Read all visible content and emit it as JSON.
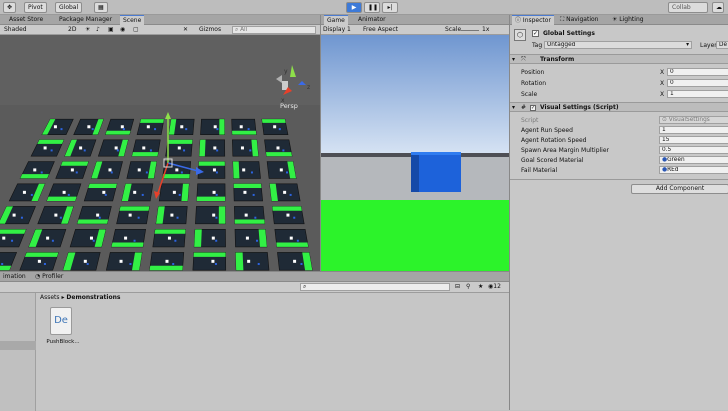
{
  "toolbar": {
    "pivot": "Pivot",
    "global": "Global",
    "collab": "Collab"
  },
  "left_tabs": [
    "Asset Store",
    "Package Manager",
    "Scene"
  ],
  "scene_bar": {
    "shading": "Shaded",
    "mode": "2D",
    "gizmos": "Gizmos",
    "search": "All",
    "persp": "Persp"
  },
  "game_tabs": [
    "Game",
    "Animator"
  ],
  "game_bar": {
    "display": "Display 1",
    "aspect": "Free Aspect",
    "scale_label": "Scale",
    "scale_value": "1x"
  },
  "bottom_tabs": [
    "imation",
    "Profiler"
  ],
  "project": {
    "breadcrumb_root": "Assets",
    "breadcrumb_sep": "▸",
    "breadcrumb_child": "Demonstrations",
    "count": "12",
    "asset_icon_text": "De",
    "asset_label": "PushBlock..."
  },
  "inspector": {
    "tabs": [
      "Inspector",
      "Navigation",
      "Lighting"
    ],
    "object_name": "Global Settings",
    "tag_label": "Tag",
    "tag_value": "Untagged",
    "layer_label": "Layer",
    "layer_value": "De",
    "transform_title": "Transform",
    "transform": [
      {
        "label": "Position",
        "axis": "X",
        "value": "0"
      },
      {
        "label": "Rotation",
        "axis": "X",
        "value": "0"
      },
      {
        "label": "Scale",
        "axis": "X",
        "value": "1"
      }
    ],
    "script_title": "Visual Settings (Script)",
    "script_label": "Script",
    "script_value": "VisualSettings",
    "props": [
      {
        "label": "Agent Run Speed",
        "value": "1"
      },
      {
        "label": "Agent Rotation Speed",
        "value": "15"
      },
      {
        "label": "Spawn Area Margin Multiplier",
        "value": "0.5"
      },
      {
        "label": "Goal Scored Material",
        "value": "Green"
      },
      {
        "label": "Fail Material",
        "value": "REd"
      }
    ],
    "add_component": "Add Component"
  },
  "colors": {
    "scene_bg": "#5a5a5a",
    "tile": "#1f2a36",
    "tile_stripe": "#32f045",
    "sky_top": "#6f96d0",
    "sky_bottom": "#d5e2f3",
    "ground": "#2cf32a",
    "block": "#1b5fd6"
  }
}
